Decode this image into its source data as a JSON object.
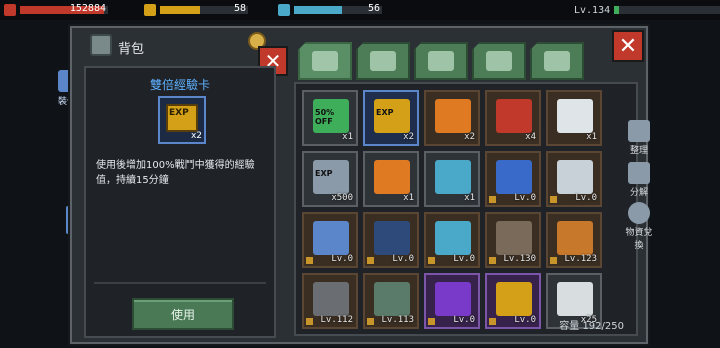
{
  "top_bar": {
    "hp": {
      "value": "152884",
      "fill": 0.95,
      "color": "#c0392b"
    },
    "energy": {
      "value": "58",
      "fill": 0.45,
      "color": "#d4a017"
    },
    "mana": {
      "value": "56",
      "fill": 0.55,
      "color": "#4aa8c9"
    },
    "level": {
      "label": "Lv.134",
      "fill": 0.05,
      "color": "#3fae5a"
    }
  },
  "panel": {
    "title": "背包",
    "selected_item": {
      "name": "雙倍經驗卡",
      "description": "使用後增加100%戰鬥中獲得的經驗值，持續15分鐘",
      "count": "x2",
      "badge": "EXP"
    },
    "use_button": "使用",
    "close_label": "✕",
    "tabs": [
      {
        "name": "bag",
        "icon": "backpack-icon"
      },
      {
        "name": "medical",
        "icon": "medkit-icon"
      },
      {
        "name": "armor",
        "icon": "armor-icon"
      },
      {
        "name": "weapon",
        "icon": "gun-icon"
      },
      {
        "name": "materials",
        "icon": "scroll-icon"
      }
    ],
    "capacity": "容量 192/250"
  },
  "items": [
    {
      "name": "sale-card",
      "label": "50% OFF",
      "count": "x1",
      "kind": "grey",
      "color": "#3fae5a"
    },
    {
      "name": "exp-card",
      "label": "EXP",
      "count": "x2",
      "kind": "blue",
      "color": "#d4a017"
    },
    {
      "name": "orange-crate",
      "label": "",
      "count": "x2",
      "kind": "",
      "color": "#e07a22"
    },
    {
      "name": "red-crate",
      "label": "",
      "count": "x4",
      "kind": "",
      "color": "#c0392b"
    },
    {
      "name": "white-crate",
      "label": "",
      "count": "x1",
      "kind": "",
      "color": "#dfe4e8"
    },
    {
      "name": "exp-shield",
      "label": "EXP",
      "count": "x500",
      "kind": "grey",
      "color": "#8a9aa8"
    },
    {
      "name": "orange-box",
      "label": "",
      "count": "x1",
      "kind": "grey",
      "color": "#e07a22"
    },
    {
      "name": "chip",
      "label": "",
      "count": "x1",
      "kind": "grey",
      "color": "#4aa8c9"
    },
    {
      "name": "gauntlet",
      "label": "",
      "count": "Lv.0",
      "kind": "",
      "color": "#3a6ac9"
    },
    {
      "name": "mech-armor",
      "label": "",
      "count": "Lv.0",
      "kind": "",
      "color": "#c8d0d8"
    },
    {
      "name": "helmet-blue",
      "label": "",
      "count": "Lv.0",
      "kind": "",
      "color": "#5b86c9"
    },
    {
      "name": "helmet-dark",
      "label": "",
      "count": "Lv.0",
      "kind": "",
      "color": "#2e4a7a"
    },
    {
      "name": "generator",
      "label": "",
      "count": "Lv.0",
      "kind": "",
      "color": "#4aa8c9"
    },
    {
      "name": "crossbow",
      "label": "",
      "count": "Lv.130",
      "kind": "",
      "color": "#7a6a5a"
    },
    {
      "name": "rifle-orange",
      "label": "",
      "count": "Lv.123",
      "kind": "",
      "color": "#c8782a"
    },
    {
      "name": "assault-rifle",
      "label": "",
      "count": "Lv.112",
      "kind": "",
      "color": "#6a6e72"
    },
    {
      "name": "sniper-rig",
      "label": "",
      "count": "Lv.113",
      "kind": "",
      "color": "#5a7a6a"
    },
    {
      "name": "lightning-case",
      "label": "",
      "count": "Lv.0",
      "kind": "purple",
      "color": "#7a3ac9"
    },
    {
      "name": "shield-case",
      "label": "",
      "count": "Lv.0",
      "kind": "purple",
      "color": "#d4a017"
    },
    {
      "name": "drill-bit",
      "label": "",
      "count": "x25",
      "kind": "grey",
      "color": "#d8dde0"
    }
  ],
  "side": {
    "equip": "裝備",
    "organize": "整理",
    "decompose": "分解",
    "exchange": "物資兌換"
  }
}
